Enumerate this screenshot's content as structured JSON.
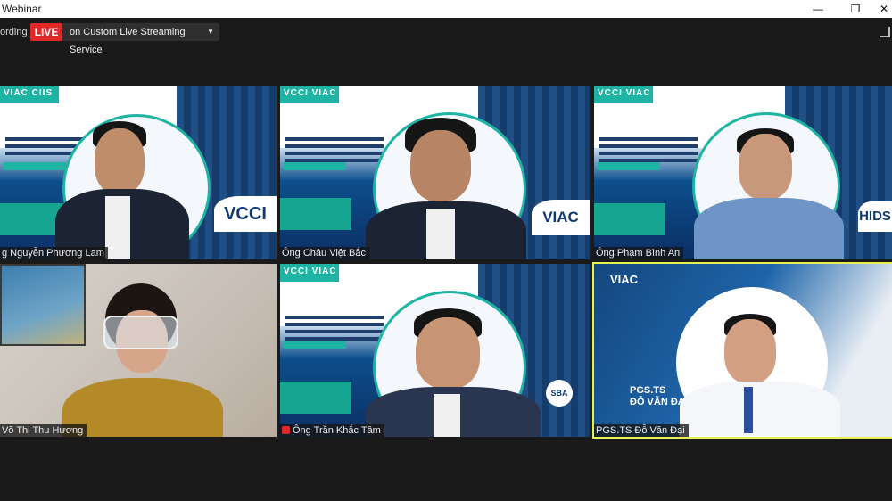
{
  "window": {
    "title": "Webinar",
    "minimize": "—",
    "maximize": "❐",
    "close": "✕"
  },
  "toolbar": {
    "recording_label": "ording",
    "live_label": "LIVE",
    "stream_service": "on Custom Live Streaming Service",
    "stream_caret": "▼"
  },
  "tiles": [
    {
      "name": "Nguyễn Phương Lam",
      "label": "g Nguyễn Phương Lam",
      "brand": "VCCI",
      "logos": "VIAC CIIS",
      "muted": false
    },
    {
      "name": "Ông Châu Việt Bắc",
      "label": "Ông Châu Việt Bắc",
      "brand": "VIAC",
      "logos": "VCCI VIAC CIIS",
      "muted": false
    },
    {
      "name": "Ông Phạm Bình An",
      "label": "Ông Phạm Bình An",
      "brand": "HIDS",
      "logos": "VCCI VIAC CIIS",
      "muted": false
    },
    {
      "name": "Võ Thị Thu Hương",
      "label": "Võ Thị Thu Hương",
      "brand": "",
      "logos": "",
      "muted": false
    },
    {
      "name": "Ông Trần Khắc Tâm",
      "label": "Ông Trần Khắc Tâm",
      "brand": "SBA",
      "logos": "VCCI VIAC CIIS",
      "muted": true
    },
    {
      "name": "PGS.TS Đỗ Văn Đại",
      "label": "PGS.TS Đỗ Văn Đại",
      "brand": "VIAC",
      "slide_title": "PGS.TS",
      "slide_subtitle": "ĐỖ VĂN ĐẠI",
      "muted": false,
      "active_speaker": true
    }
  ],
  "colors": {
    "live": "#e02828",
    "active_border": "#e7f051",
    "teal": "#1fb3a4",
    "background": "#1a1a1a"
  }
}
